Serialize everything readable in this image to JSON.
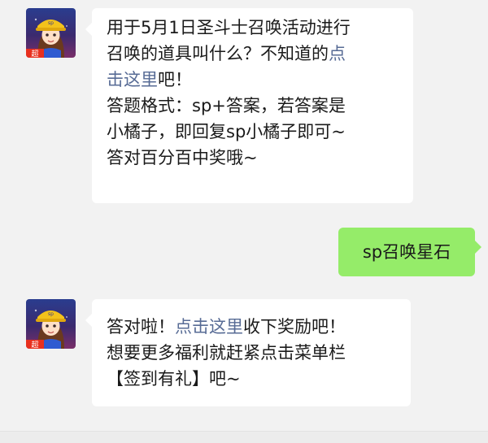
{
  "messages": [
    {
      "sender": "official",
      "avatar_icon": "cartoon-girl-avatar-icon",
      "avatar_badge": "超",
      "lines": [
        {
          "text": "用于5月1日圣斗士召唤活动进行"
        },
        {
          "text": "召唤的道具叫什么？不知道的",
          "link": "点"
        },
        {
          "link": "击这里",
          "text_after": "吧！"
        },
        {
          "text": "答题格式：sp+答案，若答案是"
        },
        {
          "text": "小橘子，即回复sp小橘子即可~"
        },
        {
          "text": "答对百分百中奖哦~"
        }
      ]
    },
    {
      "sender": "user",
      "text": "sp召唤星石"
    },
    {
      "sender": "official",
      "avatar_icon": "cartoon-girl-avatar-icon",
      "avatar_badge": "超",
      "lines": [
        {
          "text": "答对啦！",
          "link": "点击这里",
          "text_after": "收下奖励吧！"
        },
        {
          "text": "想要更多福利就赶紧点击菜单栏"
        },
        {
          "text": "【签到有礼】吧~"
        }
      ]
    }
  ],
  "colors": {
    "background": "#f2f2f2",
    "bubble_incoming": "#ffffff",
    "bubble_outgoing": "#95ec69",
    "link": "#576b95",
    "text": "#1a1a1a"
  }
}
